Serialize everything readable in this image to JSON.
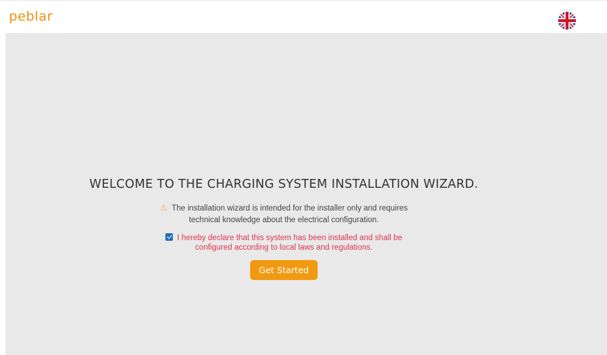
{
  "header": {
    "logo": "peblar",
    "language_flag": "uk-flag-icon"
  },
  "wizard": {
    "title": "WELCOME TO THE CHARGING SYSTEM INSTALLATION WIZARD.",
    "warning_icon": "warning-icon",
    "warning_line1": "The installation wizard is intended for the installer only and requires",
    "warning_line2": "technical knowledge about the electrical configuration.",
    "declaration_checked": true,
    "declaration_line1": "I hereby declare that this system has been installed and shall be",
    "declaration_line2": "configured according to local laws and regulations.",
    "button_label": "Get Started"
  },
  "colors": {
    "brand": "#f0900f",
    "button": "#f19a11",
    "declaration": "#e0364f",
    "warning_icon": "#f3b23a",
    "checkbox": "#1f6fb8",
    "background": "#e9e9e9"
  }
}
